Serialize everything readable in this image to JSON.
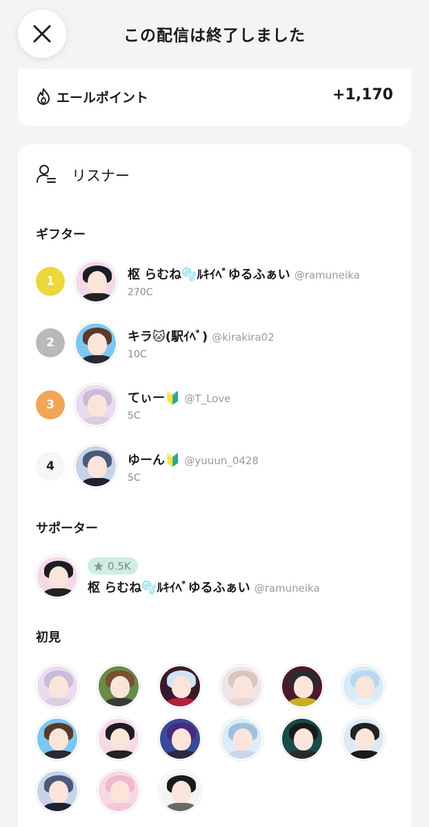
{
  "header": {
    "title": "この配信は終了しました"
  },
  "cheer": {
    "label": "エールポイント",
    "value": "+1,170"
  },
  "listeners": {
    "title": "リスナー",
    "gifters_label": "ギフター",
    "gifters": [
      {
        "rank": "1",
        "name": "枢 らむね🫧ﾙｷｲﾍﾞゆるふぁい",
        "handle": "@ramuneika",
        "coins": "270C"
      },
      {
        "rank": "2",
        "name": "キラ🐱(駅ｲﾍﾞ)",
        "handle": "@kirakira02",
        "coins": "10C"
      },
      {
        "rank": "3",
        "name": "てぃー🔰",
        "handle": "@T_Love",
        "coins": "5C"
      },
      {
        "rank": "4",
        "name": "ゆーん🔰",
        "handle": "@yuuun_0428",
        "coins": "5C"
      }
    ],
    "supporters_label": "サポーター",
    "supporter": {
      "badge": "0.5K",
      "name": "枢 らむね🫧ﾙｷｲﾍﾞゆるふぁい",
      "handle": "@ramuneika"
    },
    "first_time_label": "初見"
  },
  "colors": {
    "gold": "#ecd73c",
    "silver": "#b9b9b9",
    "bronze": "#f1a556",
    "badge_bg": "#cdeee3"
  },
  "icons": [
    "close-icon",
    "flame-icon",
    "listener-icon",
    "star-icon"
  ]
}
